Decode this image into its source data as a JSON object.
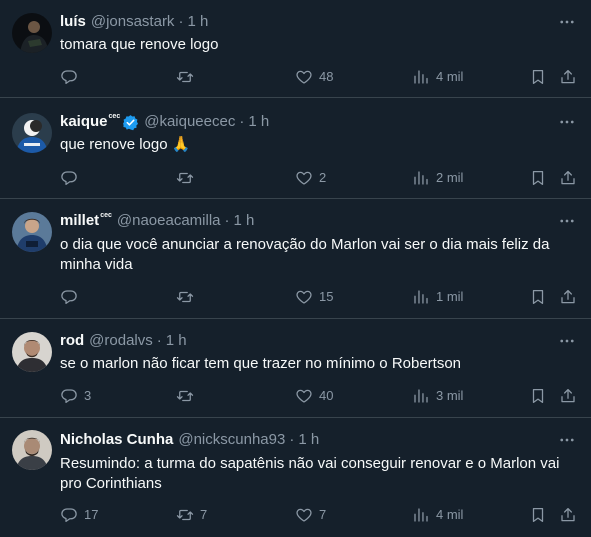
{
  "tweets": [
    {
      "name": "luís",
      "affiliate": "",
      "handle": "@jonsastark",
      "separator": "·",
      "time": "1 h",
      "text": "tomara que renove logo",
      "replies": "",
      "retweets": "",
      "likes": "48",
      "views": "4 mil"
    },
    {
      "name": "kaique",
      "affiliate": "cec",
      "verified": true,
      "handle": "@kaiqueecec",
      "separator": "·",
      "time": "1 h",
      "text": "que renove logo 🙏",
      "replies": "",
      "retweets": "",
      "likes": "2",
      "views": "2 mil"
    },
    {
      "name": "millet",
      "affiliate": "cec",
      "handle": "@naoeacamilla",
      "separator": "·",
      "time": "1 h",
      "text": "o dia que você anunciar a renovação do Marlon vai ser o dia mais feliz da minha vida",
      "replies": "",
      "retweets": "",
      "likes": "15",
      "views": "1 mil"
    },
    {
      "name": "rod",
      "affiliate": "",
      "handle": "@rodalvs",
      "separator": "·",
      "time": "1 h",
      "text": "se o marlon não ficar tem que trazer no mínimo o Robertson",
      "replies": "3",
      "retweets": "",
      "likes": "40",
      "views": "3 mil"
    },
    {
      "name": "Nicholas Cunha",
      "affiliate": "",
      "handle": "@nickscunha93",
      "separator": "·",
      "time": "1 h",
      "text": "Resumindo: a turma do sapatênis não vai conseguir renovar e o Marlon vai pro Corinthians",
      "replies": "17",
      "retweets": "7",
      "likes": "7",
      "views": "4 mil"
    }
  ],
  "colors": {
    "background": "#15202b",
    "divider": "#38444d",
    "text_primary": "#f7f9f9",
    "text_secondary": "#8b98a5",
    "verified_badge": "#1d9bf0"
  },
  "icons": {
    "reply": "speech-bubble-icon",
    "retweet": "retweet-arrows-icon",
    "like": "heart-icon",
    "views": "bar-chart-icon",
    "bookmark": "bookmark-icon",
    "share": "share-upload-icon",
    "more": "more-dots-icon",
    "verified": "verified-badge-icon"
  }
}
